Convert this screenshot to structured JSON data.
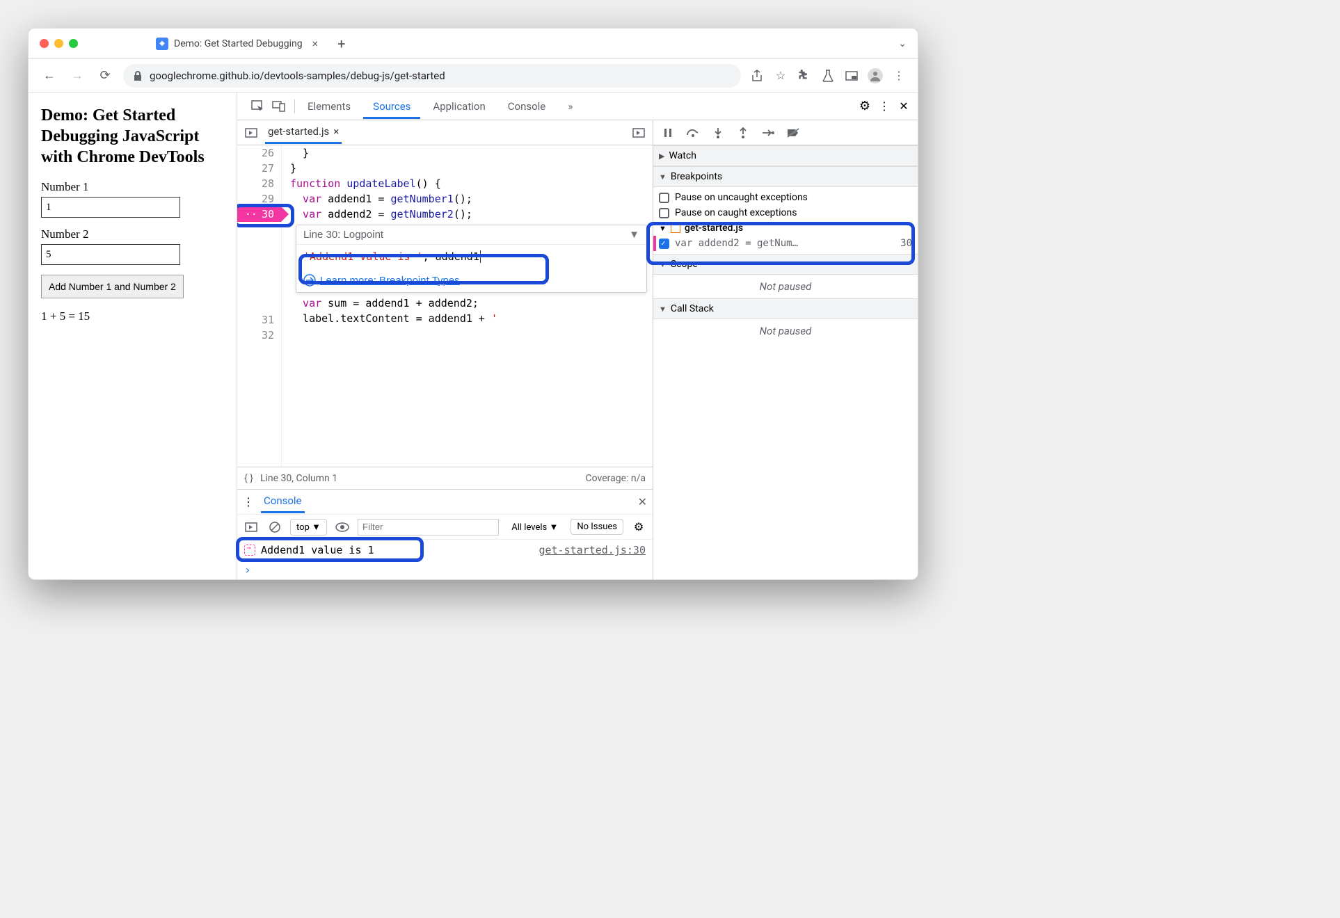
{
  "browser": {
    "tab_title": "Demo: Get Started Debugging",
    "url": "googlechrome.github.io/devtools-samples/debug-js/get-started"
  },
  "page": {
    "heading": "Demo: Get Started Debugging JavaScript with Chrome DevTools",
    "label1": "Number 1",
    "value1": "1",
    "label2": "Number 2",
    "value2": "5",
    "button": "Add Number 1 and Number 2",
    "result": "1 + 5 = 15"
  },
  "devtools": {
    "tabs": {
      "elements": "Elements",
      "sources": "Sources",
      "application": "Application",
      "console": "Console",
      "more": "»"
    },
    "file_tab": "get-started.js",
    "code": {
      "l26": "  }",
      "l27": "}",
      "l28_a": "function",
      "l28_b": " updateLabel",
      "l28_c": "() {",
      "l29_a": "  var",
      "l29_b": " addend1 = ",
      "l29_c": "getNumber1",
      "l29_d": "();",
      "l30_a": "  var",
      "l30_b": " addend2 = ",
      "l30_c": "getNumber2",
      "l30_d": "();",
      "l31_a": "  var",
      "l31_b": " sum = addend1 + addend2;",
      "l32_a": "  label.textContent = addend1 + ",
      "l32_b": "' "
    },
    "line_numbers": {
      "l26": "26",
      "l27": "27",
      "l28": "28",
      "l29": "29",
      "l30": "30",
      "l31": "31",
      "l32": "32"
    },
    "logpoint": {
      "head": "Line 30:   Logpoint",
      "expr_str": "'Addend1 value is '",
      "expr_rest": ", addend1",
      "link": "Learn more: Breakpoint Types"
    },
    "footer": {
      "braces": "{ }",
      "pos": "Line 30, Column 1",
      "coverage": "Coverage: n/a"
    },
    "sidebar": {
      "watch": "Watch",
      "breakpoints": "Breakpoints",
      "uncaught": "Pause on uncaught exceptions",
      "caught": "Pause on caught exceptions",
      "bp_file": "get-started.js",
      "bp_code": "var addend2 = getNum…",
      "bp_line": "30",
      "scope": "Scope",
      "not_paused": "Not paused",
      "callstack": "Call Stack",
      "not_paused2": "Not paused"
    },
    "console": {
      "tab": "Console",
      "top": "top",
      "filter_ph": "Filter",
      "levels": "All levels",
      "issues": "No Issues",
      "log_text": "Addend1 value is  1",
      "log_src": "get-started.js:30"
    }
  }
}
